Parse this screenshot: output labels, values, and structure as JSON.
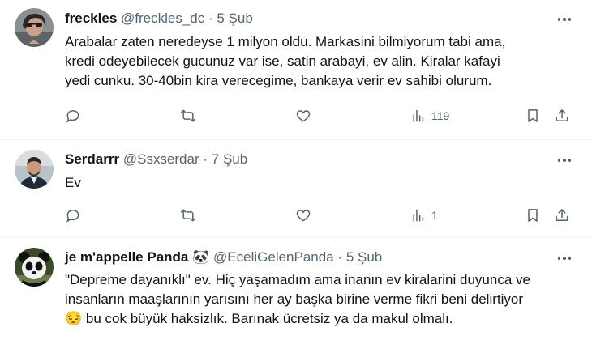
{
  "tweets": [
    {
      "name": "freckles",
      "handle": "@freckles_dc",
      "separator": "·",
      "time": "5 Şub",
      "lines": [
        "Arabalar zaten neredeyse 1 milyon oldu. Markasini bilmiyorum tabi ama,",
        "kredi odeyebilecek gucunuz var ise, satin arabayi, ev alin. Kiralar kafayi",
        "yedi cunku. 30-40bin kira verecegime, bankaya verir ev sahibi olurum."
      ],
      "views": "119"
    },
    {
      "name": "Serdarrr",
      "handle": "@Ssxserdar",
      "separator": "·",
      "time": "7 Şub",
      "lines": [
        "Ev"
      ],
      "views": "1"
    },
    {
      "name": "je m'appelle Panda",
      "name_emoji": "🐼",
      "handle": "@EceliGelenPanda",
      "separator": "·",
      "time": "5 Şub",
      "lines": [
        "\"Depreme dayanıklı\" ev. Hiç yaşamadım ama inanın ev kiralarini duyunca ve",
        "insanların maaşlarının yarısını her ay başka birine verme fikri beni delirtiyor",
        "bu cok büyük haksizlık. Barınak ücretsiz ya da makul olmalı."
      ],
      "emoji_line3": "😔"
    }
  ],
  "colors": {
    "text": "#0f1419",
    "muted": "#536471",
    "divider": "#eff3f4"
  }
}
